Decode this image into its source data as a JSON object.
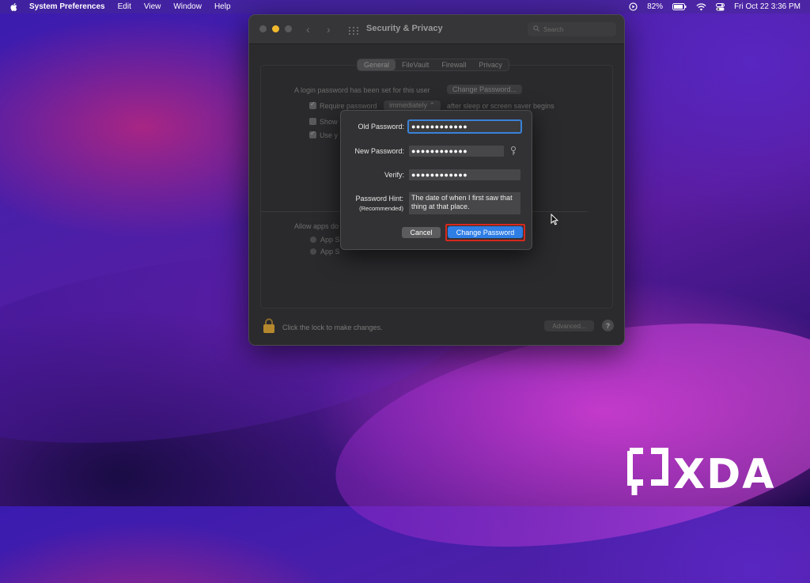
{
  "menubar": {
    "app_name": "System Preferences",
    "items": [
      "Edit",
      "View",
      "Window",
      "Help"
    ],
    "battery_percent": "82%",
    "datetime": "Fri Oct 22  3:36 PM"
  },
  "window": {
    "title": "Security & Privacy",
    "search_placeholder": "Search",
    "tabs": [
      "General",
      "FileVault",
      "Firewall",
      "Privacy"
    ],
    "active_tab": "General",
    "login_text": "A login password has been set for this user",
    "change_password_button": "Change Password...",
    "require_password_label": "Require password",
    "require_password_value": "immediately",
    "after_sleep_text": "after sleep or screen saver begins",
    "show_label": "Show",
    "use_label": "Use y",
    "allow_apps_text": "Allow apps do",
    "app_store_1": "App S",
    "app_store_2": "App S",
    "footer_text": "Click the lock to make changes.",
    "advanced_button": "Advanced...",
    "help_button": "?"
  },
  "dialog": {
    "old_password_label": "Old Password:",
    "old_password_value": "●●●●●●●●●●●●",
    "new_password_label": "New Password:",
    "new_password_value": "●●●●●●●●●●●●",
    "verify_label": "Verify:",
    "verify_value": "●●●●●●●●●●●●",
    "hint_label": "Password Hint:",
    "hint_sublabel": "(Recommended)",
    "hint_value": "The date of when I first saw that thing at that place.",
    "cancel_button": "Cancel",
    "change_button": "Change Password"
  },
  "watermark": {
    "text": "XDA"
  },
  "colors": {
    "accent_blue": "#2f7ee6",
    "highlight_red": "#d8281e",
    "traffic_red": "#5a5a5c",
    "traffic_yellow": "#f2b92e"
  }
}
